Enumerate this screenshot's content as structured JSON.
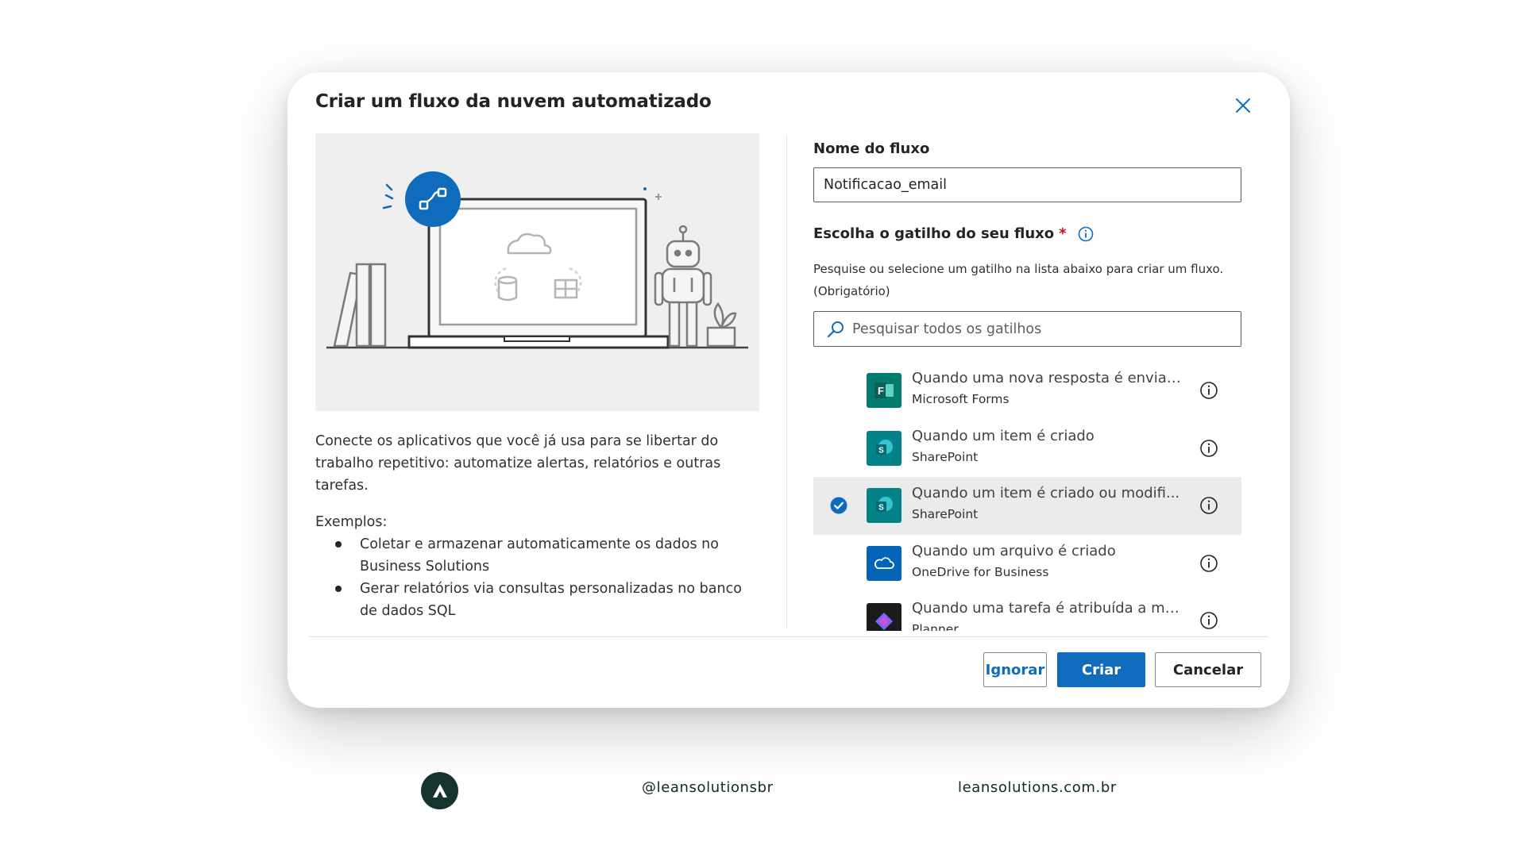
{
  "dialog": {
    "title": "Criar um fluxo da nuvem automatizado",
    "close_icon": "close-icon",
    "description": "Conecte os aplicativos que você já usa para se libertar do trabalho repetitivo: automatize alertas, relatórios e outras tarefas.",
    "examples_label": "Exemplos:",
    "examples": [
      "Coletar e armazenar automaticamente os dados no Business Solutions",
      "Gerar relatórios via consultas personalizadas no banco de dados SQL"
    ],
    "flow_name": {
      "label": "Nome do fluxo",
      "value": "Notificacao_email"
    },
    "trigger": {
      "label": "Escolha o gatilho do seu fluxo",
      "required_mark": "*",
      "help": "Pesquise ou selecione um gatilho na lista abaixo para criar um fluxo. (Obrigatório)",
      "search_placeholder": "Pesquisar todos os gatilhos",
      "items": [
        {
          "title": "Quando uma nova resposta é enviada",
          "subtitle": "Microsoft Forms",
          "icon": "microsoft-forms-icon",
          "color": "#037c70",
          "selected": false
        },
        {
          "title": "Quando um item é criado",
          "subtitle": "SharePoint",
          "icon": "sharepoint-icon",
          "color": "#038387",
          "selected": false
        },
        {
          "title": "Quando um item é criado ou modifi...",
          "subtitle": "SharePoint",
          "icon": "sharepoint-icon",
          "color": "#038387",
          "selected": true
        },
        {
          "title": "Quando um arquivo é criado",
          "subtitle": "OneDrive for Business",
          "icon": "onedrive-icon",
          "color": "#0364b8",
          "selected": false
        },
        {
          "title": "Quando uma tarefa é atribuída a mim",
          "subtitle": "Planner",
          "icon": "planner-icon",
          "color": "#31752f",
          "selected": false
        }
      ]
    },
    "buttons": {
      "ignore": "Ignorar",
      "create": "Criar",
      "cancel": "Cancelar"
    }
  },
  "footer": {
    "handle": "@leansolutionsbr",
    "site": "leansolutions.com.br"
  },
  "colors": {
    "accent": "#0f6cbd",
    "selected_row": "#ebebeb",
    "footer_brand": "#17332f"
  }
}
